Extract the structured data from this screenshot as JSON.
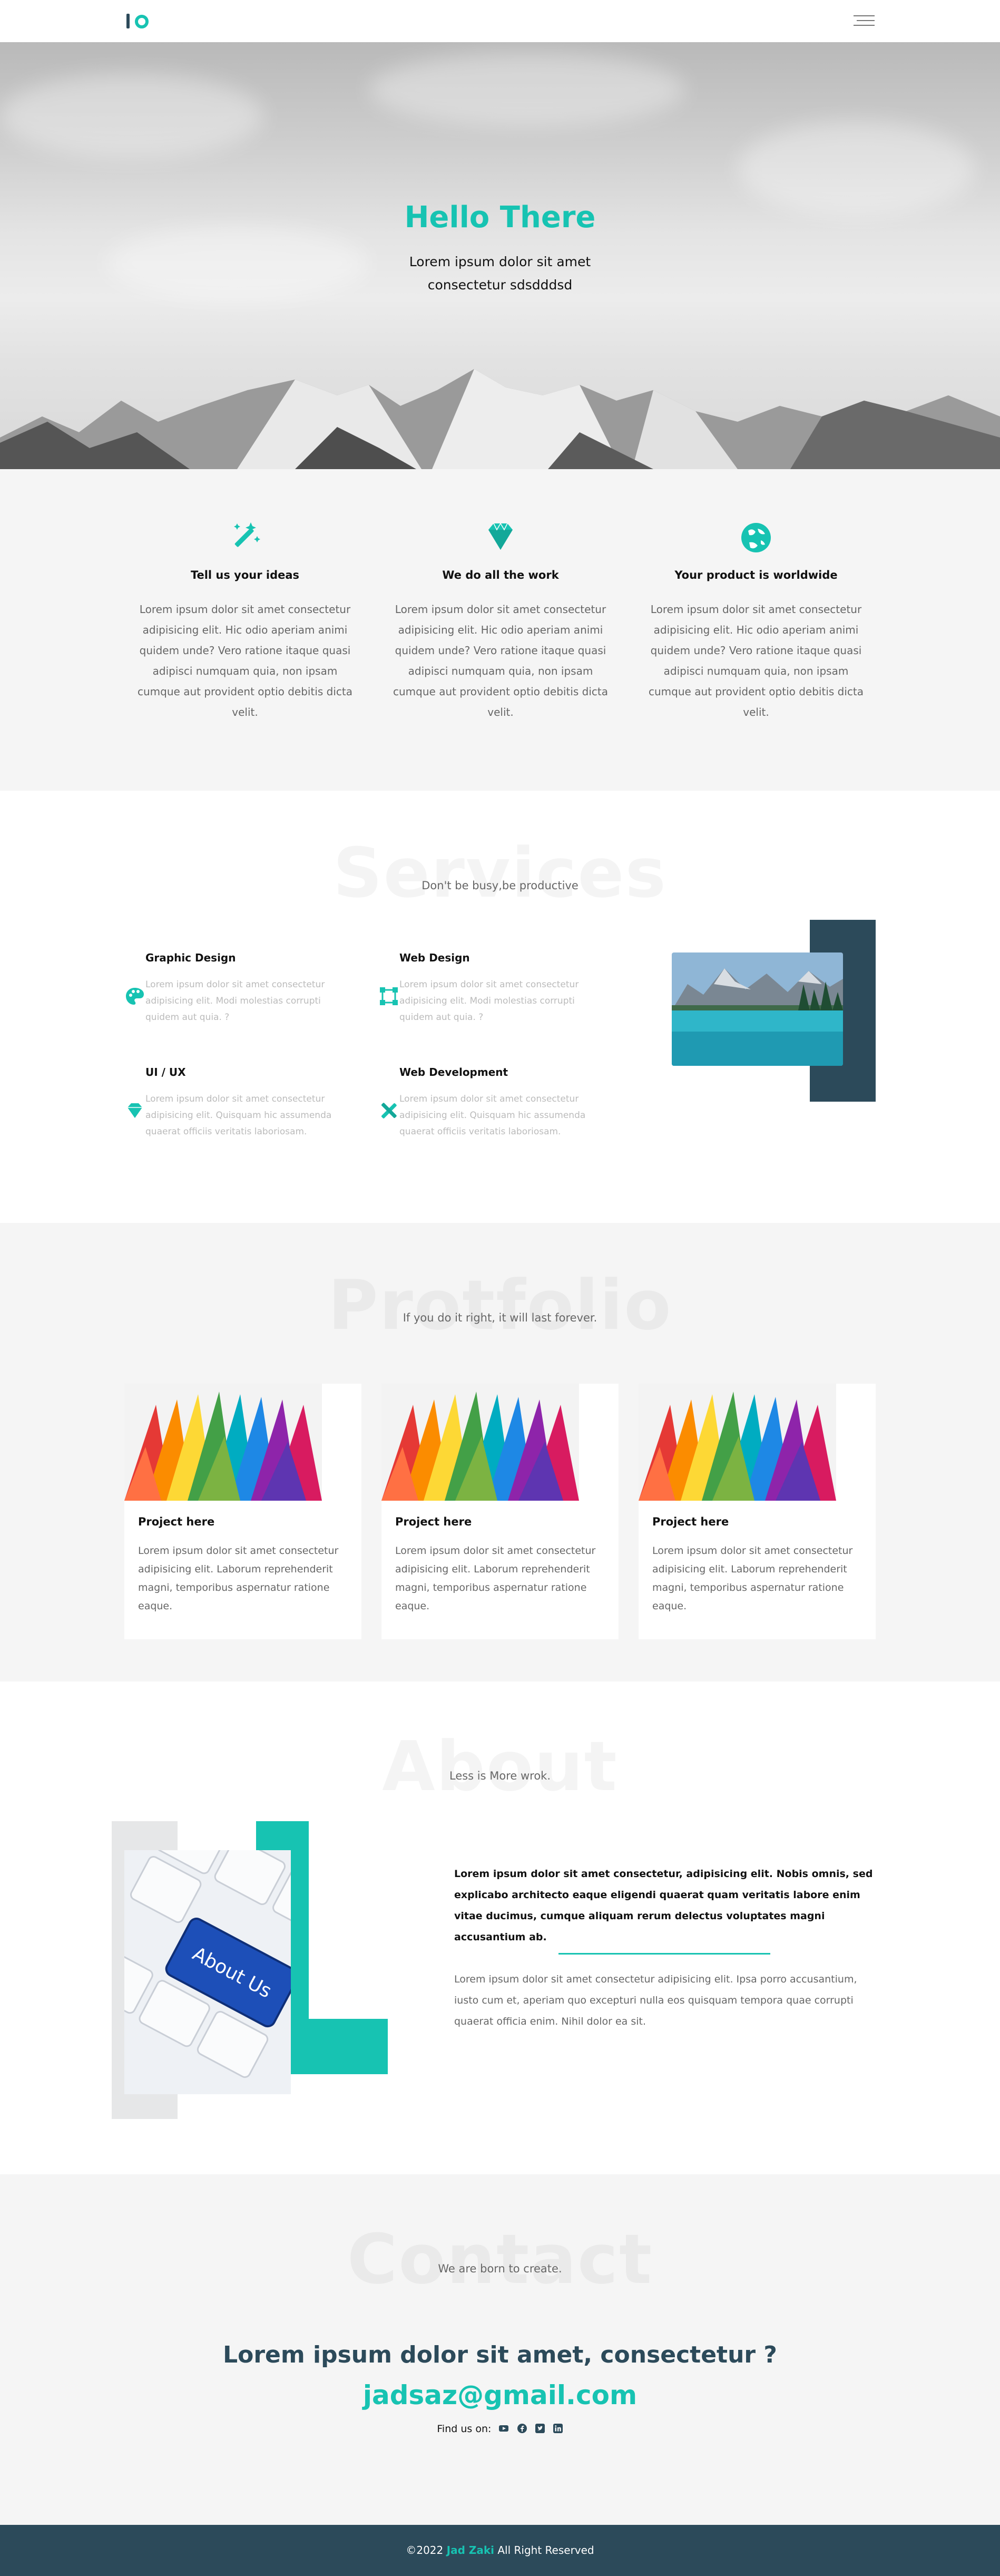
{
  "nav": {
    "logo": "logo",
    "menu_icon": "hamburger-menu-icon"
  },
  "hero": {
    "title": "Hello There",
    "subtitle": "Lorem ipsum dolor sit amet consectetur sdsdddsd"
  },
  "features": [
    {
      "icon": "magic-wand-icon",
      "title": "Tell us your ideas",
      "text": "Lorem ipsum dolor sit amet consectetur adipisicing elit. Hic odio aperiam animi quidem unde? Vero ratione itaque quasi adipisci numquam quia, non ipsam cumque aut provident optio debitis dicta velit."
    },
    {
      "icon": "diamond-icon",
      "title": "We do all the work",
      "text": "Lorem ipsum dolor sit amet consectetur adipisicing elit. Hic odio aperiam animi quidem unde? Vero ratione itaque quasi adipisci numquam quia, non ipsam cumque aut provident optio debitis dicta velit."
    },
    {
      "icon": "globe-icon",
      "title": "Your product is worldwide",
      "text": "Lorem ipsum dolor sit amet consectetur adipisicing elit. Hic odio aperiam animi quidem unde? Vero ratione itaque quasi adipisci numquam quia, non ipsam cumque aut provident optio debitis dicta velit."
    }
  ],
  "services": {
    "ghost": "Services",
    "subtitle": "Don't be busy,be productive",
    "items": [
      {
        "icon": "palette-icon",
        "title": "Graphic Design",
        "text": "Lorem ipsum dolor sit amet consectetur adipisicing elit. Modi molestias corrupti quidem aut quia. ?"
      },
      {
        "icon": "vector-square-icon",
        "title": "Web Design",
        "text": "Lorem ipsum dolor sit amet consectetur adipisicing elit. Modi molestias corrupti quidem aut quia. ?"
      },
      {
        "icon": "gem-icon",
        "title": "UI / UX",
        "text": "Lorem ipsum dolor sit amet consectetur adipisicing elit. Quisquam hic assumenda quaerat officiis veritatis laboriosam."
      },
      {
        "icon": "tools-icon",
        "title": "Web Development",
        "text": "Lorem ipsum dolor sit amet consectetur adipisicing elit. Quisquam hic assumenda quaerat officiis veritatis laboriosam."
      }
    ]
  },
  "portfolio": {
    "ghost": "Protfolio",
    "subtitle": "If you do it right, it will last forever.",
    "cards": [
      {
        "title": "Project here",
        "text": "Lorem ipsum dolor sit amet consectetur adipisicing elit. Laborum reprehenderit magni, temporibus aspernatur ratione eaque."
      },
      {
        "title": "Project here",
        "text": "Lorem ipsum dolor sit amet consectetur adipisicing elit. Laborum reprehenderit magni, temporibus aspernatur ratione eaque."
      },
      {
        "title": "Project here",
        "text": "Lorem ipsum dolor sit amet consectetur adipisicing elit. Laborum reprehenderit magni, temporibus aspernatur ratione eaque."
      }
    ]
  },
  "about": {
    "ghost": "About",
    "subtitle": "Less is More wrok.",
    "image_label": "About Us",
    "bold_text": "Lorem ipsum dolor sit amet consectetur, adipisicing elit. Nobis omnis, sed explicabo architecto eaque eligendi quaerat quam veritatis labore enim vitae ducimus, cumque aliquam rerum delectus voluptates magni accusantium ab.",
    "text": "Lorem ipsum dolor sit amet consectetur adipisicing elit. Ipsa porro accusantium, iusto cum et, aperiam quo excepturi nulla eos quisquam tempora quae corrupti quaerat officia enim. Nihil dolor ea sit."
  },
  "contact": {
    "ghost": "Contact",
    "subtitle": "We are born to create.",
    "question": "Lorem ipsum dolor sit amet, consectetur ?",
    "email": "jadsaz@gmail.com",
    "find_us": "Find us on:",
    "socials": [
      "youtube-icon",
      "facebook-icon",
      "twitter-icon",
      "linkedin-icon"
    ]
  },
  "footer": {
    "prefix": "©2022",
    "name": "Jad Zaki",
    "suffix": "All Right Reserved"
  },
  "colors": {
    "accent": "#17c3b2",
    "dark": "#2c4a5a",
    "light_bg": "#f5f5f5"
  }
}
